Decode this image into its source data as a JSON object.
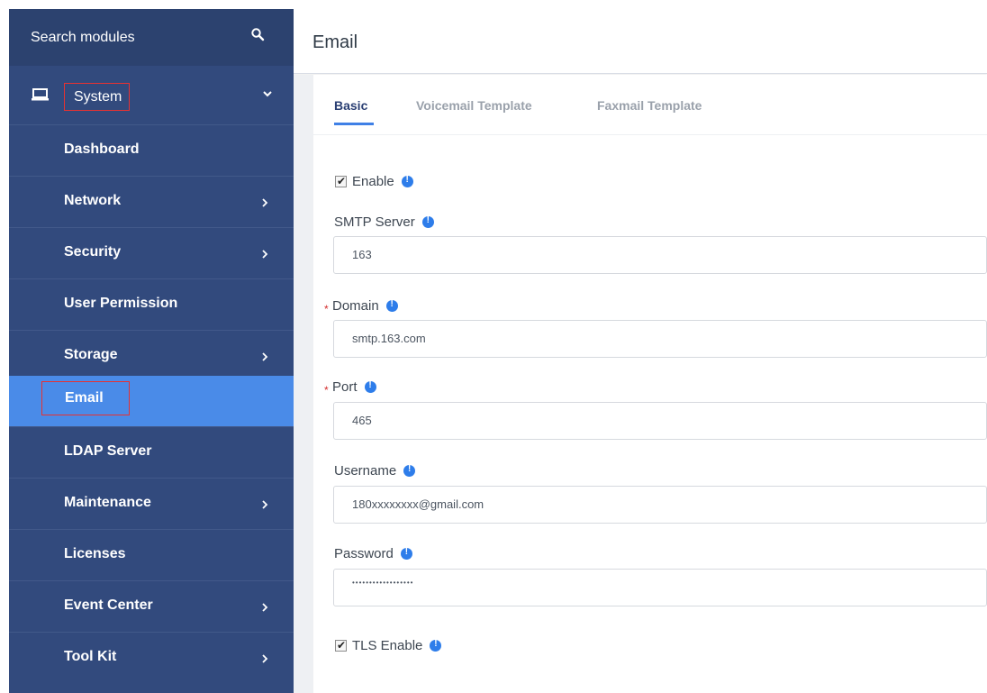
{
  "sidebar": {
    "search_label": "Search modules",
    "system_label": "System",
    "items": [
      {
        "label": "Dashboard",
        "has_children": false
      },
      {
        "label": "Network",
        "has_children": true
      },
      {
        "label": "Security",
        "has_children": true
      },
      {
        "label": "User Permission",
        "has_children": false
      },
      {
        "label": "Storage",
        "has_children": true
      },
      {
        "label": "Email",
        "has_children": false,
        "active": true
      },
      {
        "label": "LDAP Server",
        "has_children": false
      },
      {
        "label": "Maintenance",
        "has_children": true
      },
      {
        "label": "Licenses",
        "has_children": false
      },
      {
        "label": "Event Center",
        "has_children": true
      },
      {
        "label": "Tool Kit",
        "has_children": true
      }
    ]
  },
  "header": {
    "title": "Email"
  },
  "tabs": [
    {
      "label": "Basic",
      "active": true
    },
    {
      "label": "Voicemail Template",
      "active": false
    },
    {
      "label": "Faxmail Template",
      "active": false
    }
  ],
  "form": {
    "enable_label": "Enable",
    "enable_checked": true,
    "smtp_server_label": "SMTP Server",
    "smtp_server_value": "163",
    "domain_label": "Domain",
    "domain_value": "smtp.163.com",
    "port_label": "Port",
    "port_value": "465",
    "username_label": "Username",
    "username_value": "180xxxxxxxx@gmail.com",
    "password_label": "Password",
    "password_value": "••••••••••••••••••",
    "tls_label": "TLS Enable",
    "tls_checked": true,
    "required_mark": "*",
    "info_glyph": "!"
  },
  "colors": {
    "sidebar_bg": "#324a7d",
    "active_item_bg": "#4a8be8",
    "highlight_border": "#e63232",
    "accent_blue": "#2e7dea"
  },
  "icons": {
    "search": "search-icon",
    "system": "monitor-icon",
    "chevron_down": "chevron-down-icon",
    "chevron_right": "chevron-right-icon",
    "info": "info-icon",
    "checkbox": "checkbox-icon"
  }
}
